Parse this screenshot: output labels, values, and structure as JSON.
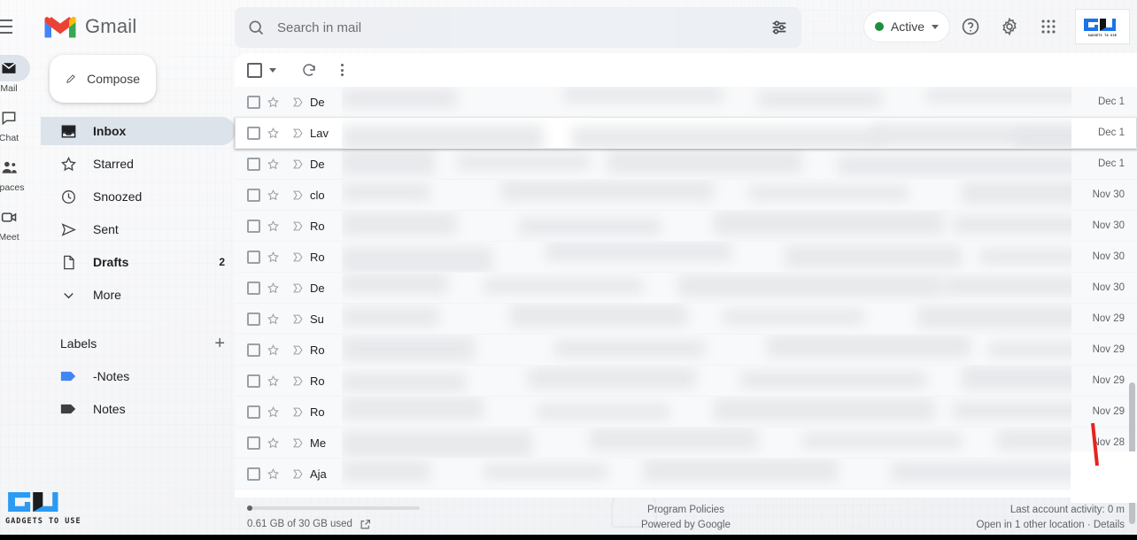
{
  "header": {
    "brand": "Gmail",
    "menu_icon": "hamburger-icon",
    "status_chip": {
      "label": "Active",
      "color": "#1e8e3e"
    },
    "help_icon": "help-circle-icon",
    "settings_icon": "gear-icon",
    "apps_icon": "apps-grid-icon",
    "logo": {
      "text": "GU",
      "tagline": "GADGETS TO USE"
    }
  },
  "search": {
    "placeholder": "Search in mail",
    "search_icon": "search-icon",
    "filter_icon": "tune-filter-icon"
  },
  "rail": {
    "items": [
      {
        "label": "Mail",
        "icon": "mail-icon",
        "active": true
      },
      {
        "label": "Chat",
        "icon": "chat-icon",
        "active": false
      },
      {
        "label": "Spaces",
        "icon": "spaces-icon",
        "active": false
      },
      {
        "label": "Meet",
        "icon": "meet-icon",
        "active": false
      }
    ]
  },
  "sidebar": {
    "compose": {
      "label": "Compose",
      "icon": "pencil-icon"
    },
    "nav": [
      {
        "label": "Inbox",
        "icon": "inbox-icon",
        "count": "",
        "selected": true
      },
      {
        "label": "Starred",
        "icon": "star-icon",
        "count": "",
        "selected": false
      },
      {
        "label": "Snoozed",
        "icon": "clock-icon",
        "count": "",
        "selected": false
      },
      {
        "label": "Sent",
        "icon": "send-icon",
        "count": "",
        "selected": false
      },
      {
        "label": "Drafts",
        "icon": "draft-icon",
        "count": "2",
        "selected": false
      },
      {
        "label": "More",
        "icon": "chevron-down-icon",
        "count": "",
        "selected": false
      }
    ],
    "labels_header": {
      "title": "Labels",
      "add_icon": "plus-icon"
    },
    "labels": [
      {
        "label": "-Notes",
        "color": "#4285f4"
      },
      {
        "label": "Notes",
        "color": "#3c4043"
      }
    ]
  },
  "list_toolbar": {
    "select_all_icon": "checkbox-icon",
    "select_dropdown_icon": "chevron-down-icon",
    "refresh_icon": "refresh-icon",
    "more_icon": "more-vertical-icon"
  },
  "mail_rows": [
    {
      "sender": "De",
      "date": "Dec 1",
      "hovered": false
    },
    {
      "sender": "Lav",
      "date": "Dec 1",
      "hovered": true
    },
    {
      "sender": "De",
      "date": "Dec 1",
      "hovered": false
    },
    {
      "sender": "clo",
      "date": "Nov 30",
      "hovered": false
    },
    {
      "sender": "Ro",
      "date": "Nov 30",
      "hovered": false
    },
    {
      "sender": "Ro",
      "date": "Nov 30",
      "hovered": false
    },
    {
      "sender": "De",
      "date": "Nov 30",
      "hovered": false
    },
    {
      "sender": "Su",
      "date": "Nov 29",
      "hovered": false
    },
    {
      "sender": "Ro",
      "date": "Nov 29",
      "hovered": false
    },
    {
      "sender": "Ro",
      "date": "Nov 29",
      "hovered": false
    },
    {
      "sender": "Ro",
      "date": "Nov 29",
      "hovered": false
    },
    {
      "sender": "Me",
      "date": "Nov 28",
      "hovered": false
    },
    {
      "sender": "Aja",
      "date": "",
      "hovered": false
    }
  ],
  "footer": {
    "storage": "0.61 GB of 30 GB used",
    "storage_link_icon": "external-link-icon",
    "program_policies": "Program Policies",
    "powered_by": "Powered by Google",
    "last_activity": "Last account activity: 0 m",
    "other_location": "Open in 1 other location · Details"
  },
  "watermark": {
    "text": "GU",
    "tagline": "GADGETS TO USE"
  }
}
